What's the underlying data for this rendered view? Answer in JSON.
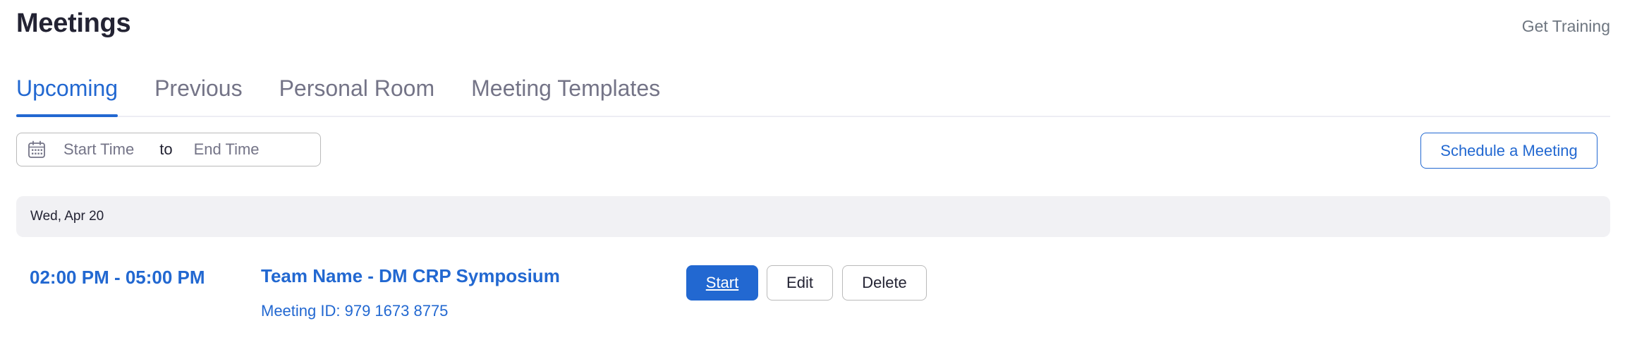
{
  "header": {
    "title": "Meetings",
    "get_training": "Get Training"
  },
  "tabs": [
    {
      "label": "Upcoming",
      "active": true
    },
    {
      "label": "Previous",
      "active": false
    },
    {
      "label": "Personal Room",
      "active": false
    },
    {
      "label": "Meeting Templates",
      "active": false
    }
  ],
  "filter": {
    "icon": "calendar-icon",
    "start_placeholder": "Start Time",
    "separator": "to",
    "end_placeholder": "End Time"
  },
  "schedule_button": "Schedule a Meeting",
  "groups": [
    {
      "date": "Wed, Apr 20",
      "meetings": [
        {
          "time": "02:00 PM - 05:00 PM",
          "topic": "Team Name - DM CRP Symposium",
          "meeting_id": "Meeting ID: 979 1673 8775",
          "actions": {
            "start": "Start",
            "edit": "Edit",
            "delete": "Delete"
          }
        }
      ]
    }
  ],
  "colors": {
    "accent": "#2268d1",
    "tab_inactive": "#747487",
    "date_header_bg": "#f1f1f4",
    "text": "#232333"
  }
}
